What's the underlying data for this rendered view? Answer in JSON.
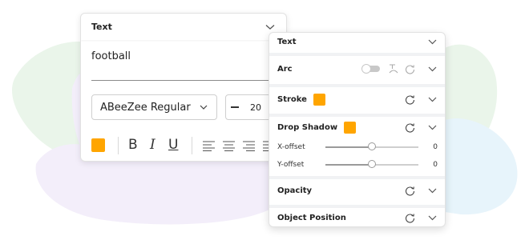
{
  "colors": {
    "accent": "#ffa500",
    "panel_bg": "#ffffff",
    "blob_green": "#eaf5ea",
    "blob_purple": "#f3eefa",
    "blob_blue": "#e7f4fb"
  },
  "text_panel": {
    "title": "Text",
    "text_value": "football",
    "font_family": "ABeeZee Regular",
    "font_size": "20",
    "format_buttons": [
      "B",
      "I",
      "U"
    ]
  },
  "properties_panel": {
    "text_section": {
      "label": "Text"
    },
    "arc_section": {
      "label": "Arc",
      "enabled": false
    },
    "stroke_section": {
      "label": "Stroke"
    },
    "drop_shadow_section": {
      "label": "Drop Shadow",
      "x_offset": {
        "label": "X-offset",
        "value": "0",
        "level": 0.5
      },
      "y_offset": {
        "label": "Y-offset",
        "value": "0",
        "level": 0.5
      }
    },
    "opacity_section": {
      "label": "Opacity"
    },
    "object_position_section": {
      "label": "Object Position"
    }
  }
}
